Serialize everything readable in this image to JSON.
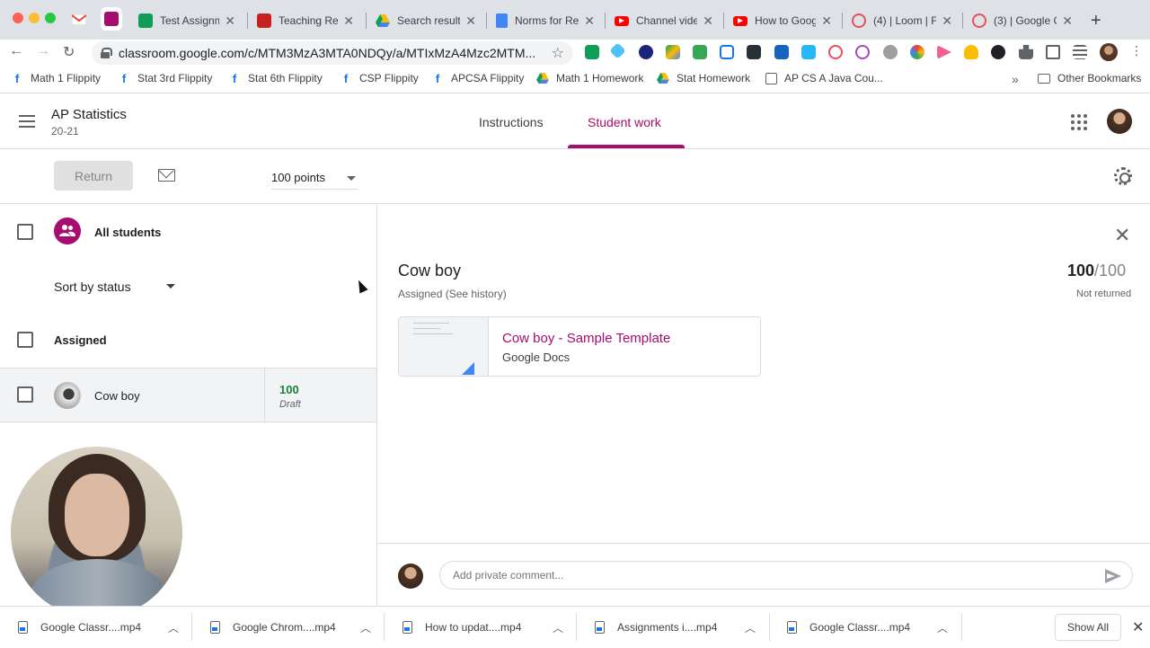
{
  "browser": {
    "tabs": [
      {
        "label": "Test Assignm",
        "favicon": "classroom-icon",
        "color": "#0f9d58"
      },
      {
        "label": "Teaching Ren",
        "favicon": "flippity-icon",
        "color": "#c5221f"
      },
      {
        "label": "Search result",
        "favicon": "drive-icon",
        "color": "#fbbc04"
      },
      {
        "label": "Norms for Re",
        "favicon": "docs-icon",
        "color": "#4285f4"
      },
      {
        "label": "Channel vide",
        "favicon": "youtube-icon",
        "color": "#ff0000"
      },
      {
        "label": "How to Goog",
        "favicon": "youtube-icon",
        "color": "#ff0000"
      },
      {
        "label": "(4) | Loom | F",
        "favicon": "loom-icon",
        "color": "#e8505b"
      },
      {
        "label": "(3) | Google C",
        "favicon": "loom-icon",
        "color": "#e8505b"
      }
    ],
    "url": "classroom.google.com/c/MTM3MzA3MTA0NDQy/a/MTIxMzA4Mzc2MTM...",
    "bookmarks": [
      {
        "label": "Math 1 Flippity",
        "icon": "flippity-icon"
      },
      {
        "label": "Stat 3rd Flippity",
        "icon": "flippity-icon"
      },
      {
        "label": "Stat 6th Flippity",
        "icon": "flippity-icon"
      },
      {
        "label": "CSP Flippity",
        "icon": "flippity-icon"
      },
      {
        "label": "APCSA Flippity",
        "icon": "flippity-icon"
      },
      {
        "label": "Math 1 Homework",
        "icon": "drive-icon"
      },
      {
        "label": "Stat Homework",
        "icon": "drive-icon"
      },
      {
        "label": "AP CS A Java Cou...",
        "icon": "page-icon"
      }
    ],
    "bookmarks_more": "»",
    "other_bookmarks": "Other Bookmarks"
  },
  "header": {
    "class_name": "AP Statistics",
    "class_section": "20-21",
    "tabs": {
      "instructions": "Instructions",
      "student_work": "Student work"
    }
  },
  "actions": {
    "return_label": "Return",
    "points_label": "100 points"
  },
  "roster": {
    "all_students": "All students",
    "sort_label": "Sort by status",
    "assigned_label": "Assigned",
    "students": [
      {
        "name": "Cow boy",
        "grade": "100",
        "status": "Draft"
      }
    ]
  },
  "detail": {
    "student_name": "Cow boy",
    "status_text": "Assigned (See history)",
    "score": "100",
    "score_total": "/100",
    "return_status": "Not returned",
    "attachment": {
      "title": "Cow boy - Sample Template",
      "type": "Google Docs"
    },
    "comment_placeholder": "Add private comment..."
  },
  "downloads": {
    "items": [
      "Google Classr....mp4",
      "Google Chrom....mp4",
      "How to updat....mp4",
      "Assignments i....mp4",
      "Google Classr....mp4"
    ],
    "show_all": "Show All"
  },
  "colors": {
    "accent": "#a50e6e",
    "grade_green": "#188038"
  }
}
